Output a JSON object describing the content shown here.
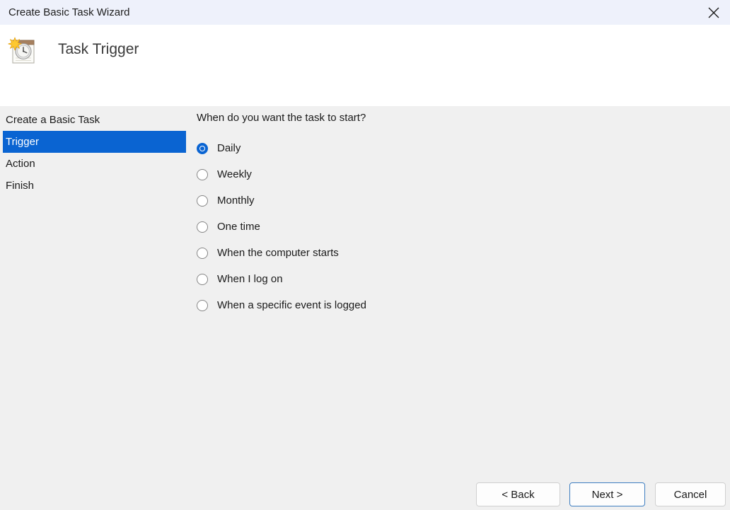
{
  "window": {
    "title": "Create Basic Task Wizard",
    "close_icon": "close-icon"
  },
  "header": {
    "icon": "task-scheduler-clock-calendar-icon",
    "title": "Task Trigger"
  },
  "sidebar": {
    "items": [
      {
        "label": "Create a Basic Task",
        "selected": false
      },
      {
        "label": "Trigger",
        "selected": true
      },
      {
        "label": "Action",
        "selected": false
      },
      {
        "label": "Finish",
        "selected": false
      }
    ]
  },
  "main": {
    "question": "When do you want the task to start?",
    "options": [
      {
        "label": "Daily",
        "checked": true
      },
      {
        "label": "Weekly",
        "checked": false
      },
      {
        "label": "Monthly",
        "checked": false
      },
      {
        "label": "One time",
        "checked": false
      },
      {
        "label": "When the computer starts",
        "checked": false
      },
      {
        "label": "When I log on",
        "checked": false
      },
      {
        "label": "When a specific event is logged",
        "checked": false
      }
    ]
  },
  "footer": {
    "back_label": "< Back",
    "next_label": "Next >",
    "cancel_label": "Cancel"
  },
  "colors": {
    "accent": "#0a64d2",
    "titlebar_bg": "#eef1fb",
    "header_bg": "#ffffff",
    "body_bg": "#f0f0f0",
    "focus_border": "#3f7fc1"
  }
}
